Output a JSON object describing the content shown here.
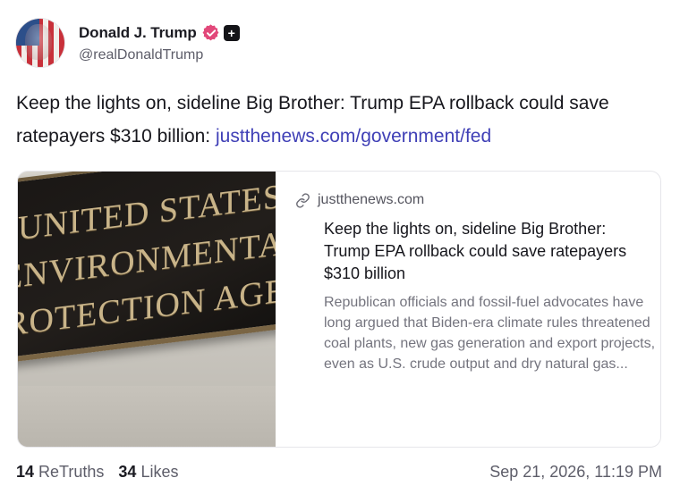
{
  "author": {
    "display_name": "Donald J. Trump",
    "handle": "@realDonaldTrump",
    "verified_icon": "verified-badge-icon",
    "extra_badge_icon": "plus-badge-icon"
  },
  "post": {
    "text": "Keep the lights on, sideline Big Brother: Trump EPA rollback could save ratepayers $310 billion: ",
    "link_text": "justthenews.com/government/fed"
  },
  "link_card": {
    "image_plaque_lines": [
      "UNITED STATES",
      "ENVIRONMENTAL",
      "PROTECTION AGENCY"
    ],
    "domain": "justthenews.com",
    "title": "Keep the lights on, sideline Big Brother: Trump EPA rollback could save ratepayers $310 billion",
    "description": "Republican officials and fossil-fuel advocates have long argued that Biden-era climate rules threatened coal plants, new gas generation and export projects, even as U.S. crude output and dry natural gas..."
  },
  "stats": {
    "retruths_count": "14",
    "retruths_label": "ReTruths",
    "likes_count": "34",
    "likes_label": "Likes"
  },
  "timestamp": "Sep 21, 2026, 11:19 PM",
  "colors": {
    "link": "#3f3fb6",
    "verified": "#e2487a",
    "plaque_letters": "#c9b489"
  }
}
